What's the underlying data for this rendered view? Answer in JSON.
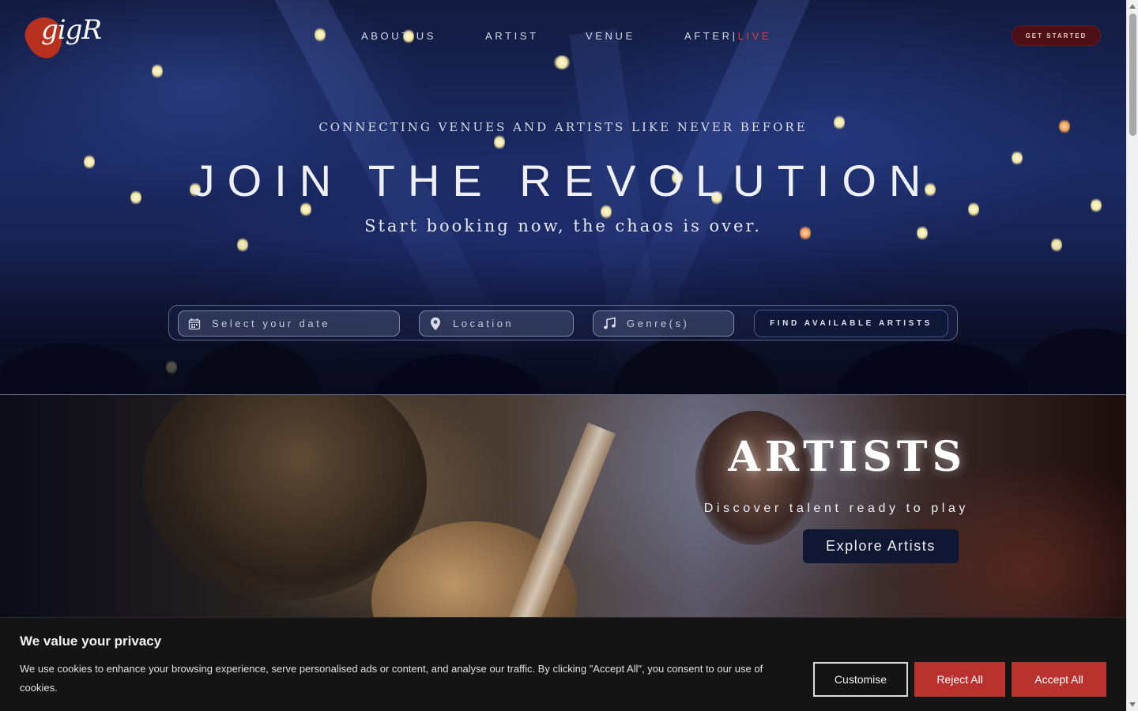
{
  "brand": {
    "logo_text": "gigR"
  },
  "nav": {
    "items": [
      {
        "label": "ABOUT US"
      },
      {
        "label": "ARTIST"
      },
      {
        "label": "VENUE"
      },
      {
        "label": "AFTER|",
        "label_accent": "LIVE"
      }
    ],
    "cta_label": "GET STARTED"
  },
  "hero": {
    "tagline": "CONNECTING VENUES AND ARTISTS LIKE NEVER BEFORE",
    "headline": "JOIN THE REVOLUTION",
    "subheadline": "Start booking now, the chaos is over."
  },
  "search": {
    "date_placeholder": "Select your date",
    "location_placeholder": "Location",
    "genre_placeholder": "Genre(s)",
    "submit_label": "FIND AVAILABLE ARTISTS",
    "icons": [
      "calendar-icon",
      "map-pin-icon",
      "music-note-icon"
    ]
  },
  "artists_section": {
    "title": "ARTISTS",
    "subtitle": "Discover talent ready to play",
    "button_label": "Explore Artists"
  },
  "cookie_banner": {
    "title": "We value your privacy",
    "body": "We use cookies to enhance your browsing experience, serve personalised ads or content, and analyse our traffic. By clicking \"Accept All\", you consent to our use of cookies.",
    "customise_label": "Customise",
    "reject_label": "Reject All",
    "accept_label": "Accept All"
  },
  "colors": {
    "brand_red": "#b8311f",
    "accent_live": "#d1403a",
    "button_navy": "#10183a",
    "cookie_button": "#b9322e"
  }
}
